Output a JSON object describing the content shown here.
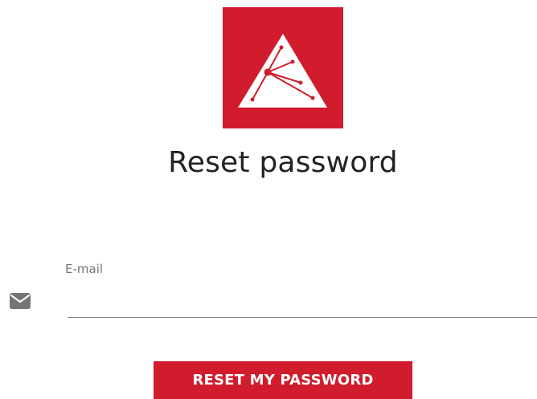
{
  "logo": {
    "icon": "triangle-network-logo-icon",
    "background_color": "#d01c2c"
  },
  "page": {
    "title": "Reset password"
  },
  "email_field": {
    "label": "E-mail",
    "value": "",
    "placeholder": "",
    "icon": "envelope-icon"
  },
  "actions": {
    "reset_label": "RESET MY PASSWORD",
    "button_color": "#d01c2c"
  }
}
